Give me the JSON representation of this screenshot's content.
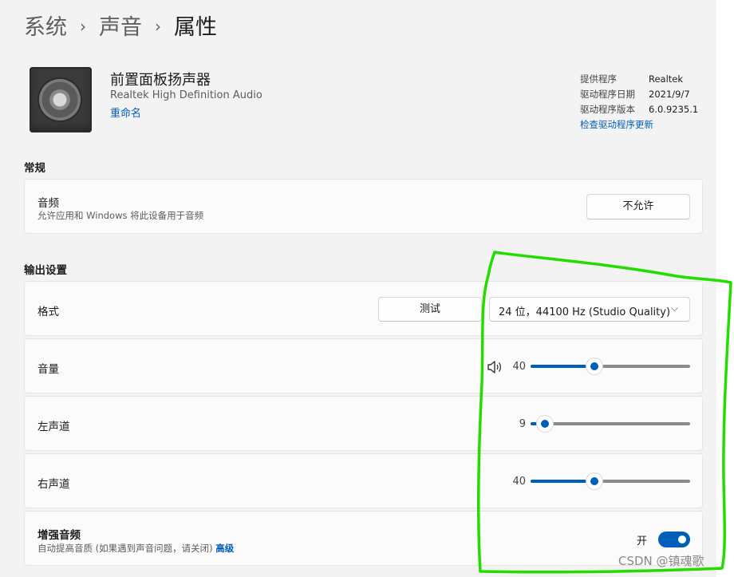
{
  "breadcrumb": {
    "items": [
      "系统",
      "声音",
      "属性"
    ],
    "separator": "›"
  },
  "device": {
    "name": "前置面板扬声器",
    "driver_name": "Realtek High Definition Audio",
    "rename_link": "重命名",
    "icon": "speaker-icon"
  },
  "driver_info": {
    "provider_label": "提供程序",
    "provider_value": "Realtek",
    "date_label": "驱动程序日期",
    "date_value": "2021/9/7",
    "version_label": "驱动程序版本",
    "version_value": "6.0.9235.1",
    "update_link": "检查驱动程序更新"
  },
  "general": {
    "title": "常规",
    "audio": {
      "label": "音频",
      "description": "允许应用和 Windows 将此设备用于音频",
      "button": "不允许"
    }
  },
  "output": {
    "title": "输出设置",
    "format": {
      "label": "格式",
      "test_button": "测试",
      "selected": "24 位，44100 Hz (Studio Quality)",
      "chevron_icon": "chevron-down-icon"
    },
    "volume": {
      "label": "音量",
      "icon": "speaker-volume-icon",
      "value": 40
    },
    "left_channel": {
      "label": "左声道",
      "value": 9
    },
    "right_channel": {
      "label": "右声道",
      "value": 40
    },
    "enhance": {
      "label": "增强音频",
      "description": "自动提高音质 (如果遇到声音问题，请关闭)",
      "advanced_link": "高级",
      "state_text": "开",
      "on": true
    }
  },
  "annotation": {
    "color": "#22dd00"
  },
  "watermark": "CSDN @镇魂歌",
  "colors": {
    "accent": "#005fb8",
    "background": "#f3f3f3",
    "card": "#fbfbfb"
  }
}
